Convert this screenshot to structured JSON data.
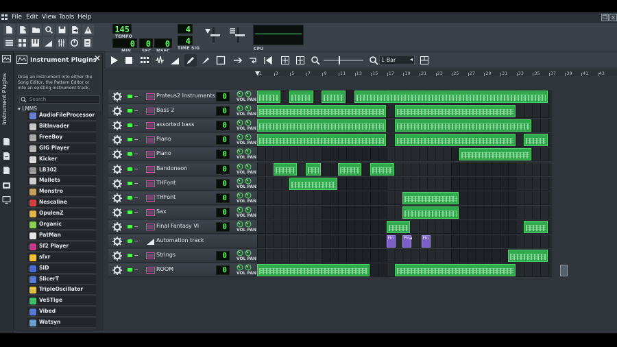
{
  "menu": {
    "items": [
      "File",
      "Edit",
      "View",
      "Tools",
      "Help"
    ]
  },
  "transport": {
    "tempo": "145",
    "tempo_label": "TEMPO",
    "time_min": "0",
    "time_sec": "0",
    "time_msec": "0",
    "min_label": "MIN",
    "sec_label": "SEC",
    "msec_label": "MSEC",
    "time_sig_num": "4",
    "time_sig_den": "4",
    "time_sig_label": "TIME SIG",
    "cpu_label": "CPU"
  },
  "sidebar": {
    "vertical_label": "Instrument Plugins"
  },
  "plugin_panel": {
    "title": "Instrument Plugins",
    "description": "Drag an instrument into either the Song Editor, the Pattern Editor or into an existing instrument track.",
    "search_placeholder": "Search",
    "tree_root": "LMMS",
    "plugins": [
      {
        "label": "AudioFileProcessor",
        "icon": "waveform-icon",
        "color": "#6a7fd1"
      },
      {
        "label": "BitInvader",
        "icon": "bitinvader-icon",
        "color": "#c8c8c8"
      },
      {
        "label": "FreeBoy",
        "icon": "freeboy-icon",
        "color": "#a9a9a9"
      },
      {
        "label": "GIG Player",
        "icon": "gig-icon",
        "color": "#b5b5b5"
      },
      {
        "label": "Kicker",
        "icon": "kicker-icon",
        "color": "#d9d9d9"
      },
      {
        "label": "LB302",
        "icon": "lb302-icon",
        "color": "#9a9a9a"
      },
      {
        "label": "Mallets",
        "icon": "mallets-icon",
        "color": "#cfcfcf"
      },
      {
        "label": "Monstro",
        "icon": "monstro-icon",
        "color": "#c4a35a"
      },
      {
        "label": "Nescaline",
        "icon": "nescaline-icon",
        "color": "#d44040"
      },
      {
        "label": "OpulenZ",
        "icon": "opulenz-icon",
        "color": "#e2b64a"
      },
      {
        "label": "Organic",
        "icon": "organic-icon",
        "color": "#8ed14f"
      },
      {
        "label": "PatMan",
        "icon": "patman-icon",
        "color": "#e6e6e6"
      },
      {
        "label": "Sf2 Player",
        "icon": "sf2-icon",
        "color": "#c83a8a"
      },
      {
        "label": "sfxr",
        "icon": "sfxr-icon",
        "color": "#f2c230"
      },
      {
        "label": "SID",
        "icon": "sid-icon",
        "color": "#4a6cd4"
      },
      {
        "label": "SlicerT",
        "icon": "slicert-icon",
        "color": "#5a7dd6"
      },
      {
        "label": "TripleOscillator",
        "icon": "tripleosc-icon",
        "color": "#e0c040"
      },
      {
        "label": "VeSTige",
        "icon": "vestige-icon",
        "color": "#3fbf6a"
      },
      {
        "label": "Vibed",
        "icon": "vibed-icon",
        "color": "#5a7bd8"
      },
      {
        "label": "Watsyn",
        "icon": "watsyn-icon",
        "color": "#6aa0d0"
      }
    ]
  },
  "song_editor": {
    "zoom_value": "1 Bar",
    "ruler_labels": [
      "1",
      "3",
      "5",
      "7",
      "9",
      "11",
      "13",
      "15",
      "17",
      "19",
      "21",
      "23",
      "25",
      "27",
      "29",
      "31",
      "33",
      "35",
      "37",
      "39",
      "41",
      "43"
    ],
    "volpan_label": "VOL PAN",
    "tracks": [
      {
        "name": "Proteus2 Instruments",
        "type": "instrument",
        "vol": "0"
      },
      {
        "name": "Bass 2",
        "type": "instrument",
        "vol": "0"
      },
      {
        "name": "assorted bass",
        "type": "instrument",
        "vol": "0"
      },
      {
        "name": "Piano",
        "type": "instrument",
        "vol": "0"
      },
      {
        "name": "Piano",
        "type": "instrument",
        "vol": "0"
      },
      {
        "name": "Bandoneon",
        "type": "instrument",
        "vol": "0"
      },
      {
        "name": "THFont",
        "type": "instrument",
        "vol": "0"
      },
      {
        "name": "THFont",
        "type": "instrument",
        "vol": "0"
      },
      {
        "name": "Sax",
        "type": "instrument",
        "vol": "0"
      },
      {
        "name": "Final Fantasy VI",
        "type": "instrument",
        "vol": "0"
      },
      {
        "name": "Automation track",
        "type": "automation",
        "vol": ""
      },
      {
        "name": "Strings",
        "type": "instrument",
        "vol": "0"
      },
      {
        "name": "ROOM",
        "type": "instrument",
        "vol": "0"
      }
    ],
    "automation_clip_labels": [
      "Fin",
      "Fina",
      "Fin"
    ]
  },
  "colors": {
    "clip_green": "#2fa94b",
    "clip_border": "#51d36c",
    "automation_purple": "#7b5fc9",
    "lcd_green": "#57ff57",
    "instrument_icon": "#e04ab0"
  }
}
